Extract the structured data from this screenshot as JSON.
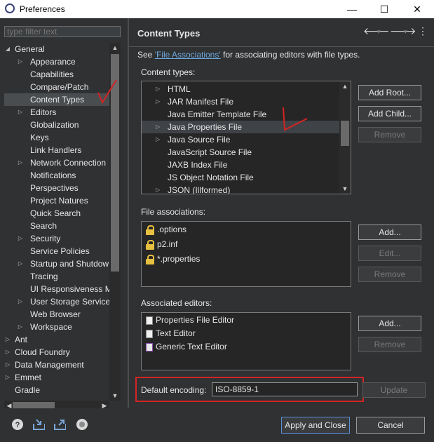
{
  "window": {
    "title": "Preferences",
    "minimize": "—",
    "maximize": "☐",
    "close": "✕"
  },
  "filter": {
    "placeholder": "type filter text"
  },
  "tree": [
    {
      "label": "General",
      "depth": 0,
      "arrow": "◢",
      "expanded": true
    },
    {
      "label": "Appearance",
      "depth": 1,
      "arrow": "▷"
    },
    {
      "label": "Capabilities",
      "depth": 1,
      "arrow": ""
    },
    {
      "label": "Compare/Patch",
      "depth": 1,
      "arrow": ""
    },
    {
      "label": "Content Types",
      "depth": 1,
      "arrow": "",
      "selected": true
    },
    {
      "label": "Editors",
      "depth": 1,
      "arrow": "▷"
    },
    {
      "label": "Globalization",
      "depth": 1,
      "arrow": ""
    },
    {
      "label": "Keys",
      "depth": 1,
      "arrow": ""
    },
    {
      "label": "Link Handlers",
      "depth": 1,
      "arrow": ""
    },
    {
      "label": "Network Connection",
      "depth": 1,
      "arrow": "▷"
    },
    {
      "label": "Notifications",
      "depth": 1,
      "arrow": ""
    },
    {
      "label": "Perspectives",
      "depth": 1,
      "arrow": ""
    },
    {
      "label": "Project Natures",
      "depth": 1,
      "arrow": ""
    },
    {
      "label": "Quick Search",
      "depth": 1,
      "arrow": ""
    },
    {
      "label": "Search",
      "depth": 1,
      "arrow": ""
    },
    {
      "label": "Security",
      "depth": 1,
      "arrow": "▷"
    },
    {
      "label": "Service Policies",
      "depth": 1,
      "arrow": ""
    },
    {
      "label": "Startup and Shutdow",
      "depth": 1,
      "arrow": "▷"
    },
    {
      "label": "Tracing",
      "depth": 1,
      "arrow": ""
    },
    {
      "label": "UI Responsiveness M",
      "depth": 1,
      "arrow": ""
    },
    {
      "label": "User Storage Service",
      "depth": 1,
      "arrow": "▷"
    },
    {
      "label": "Web Browser",
      "depth": 1,
      "arrow": ""
    },
    {
      "label": "Workspace",
      "depth": 1,
      "arrow": "▷"
    },
    {
      "label": "Ant",
      "depth": 0,
      "arrow": "▷"
    },
    {
      "label": "Cloud Foundry",
      "depth": 0,
      "arrow": "▷"
    },
    {
      "label": "Data Management",
      "depth": 0,
      "arrow": "▷"
    },
    {
      "label": "Emmet",
      "depth": 0,
      "arrow": "▷"
    },
    {
      "label": "Gradle",
      "depth": 0,
      "arrow": ""
    }
  ],
  "page": {
    "title": "Content Types",
    "see_prefix": "See ",
    "see_link": "'File Associations'",
    "see_suffix": " for associating editors with file types.",
    "content_types_label": "Content types:",
    "file_assoc_label": "File associations:",
    "assoc_editors_label": "Associated editors:",
    "default_encoding_label": "Default encoding:",
    "default_encoding_value": "ISO-8859-1"
  },
  "content_types": [
    {
      "label": "HTML",
      "arrow": "▷"
    },
    {
      "label": "JAR Manifest File",
      "arrow": "▷"
    },
    {
      "label": "Java Emitter Template File",
      "arrow": ""
    },
    {
      "label": "Java Properties File",
      "arrow": "▷",
      "selected": true
    },
    {
      "label": "Java Source File",
      "arrow": "▷"
    },
    {
      "label": "JavaScript Source File",
      "arrow": ""
    },
    {
      "label": "JAXB Index File",
      "arrow": ""
    },
    {
      "label": "JS Object Notation File",
      "arrow": ""
    },
    {
      "label": "JSON (Illformed)",
      "arrow": "▷"
    }
  ],
  "file_associations": [
    {
      "label": ".options",
      "icon": "lock-icon"
    },
    {
      "label": "p2.inf",
      "icon": "lock-icon"
    },
    {
      "label": "*.properties",
      "icon": "lock-icon"
    }
  ],
  "associated_editors": [
    {
      "label": "Properties File Editor",
      "icon": "document-icon"
    },
    {
      "label": "Text Editor",
      "icon": "document-icon"
    },
    {
      "label": "Generic Text Editor",
      "icon": "generic-editor-icon"
    }
  ],
  "buttons": {
    "add_root": "Add Root...",
    "add_child": "Add Child...",
    "remove_ct": "Remove",
    "add_fa": "Add...",
    "edit_fa": "Edit...",
    "remove_fa": "Remove",
    "add_ed": "Add...",
    "remove_ed": "Remove",
    "update": "Update",
    "apply_close": "Apply and Close",
    "cancel": "Cancel"
  },
  "colors": {
    "accent_border": "#d42424",
    "link": "#6fa8dc",
    "background": "#2f3133"
  }
}
